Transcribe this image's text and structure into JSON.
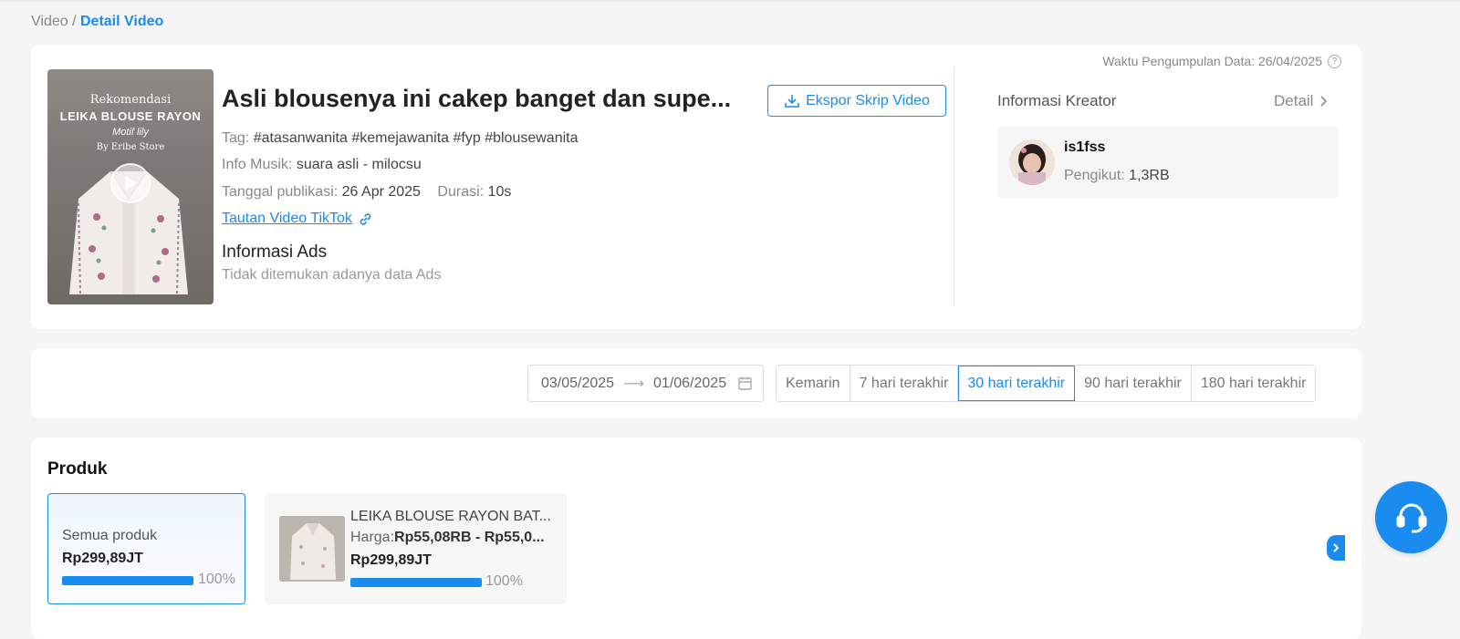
{
  "breadcrumb": {
    "root": "Video",
    "separator": "/",
    "current": "Detail Video"
  },
  "collection": {
    "label": "Waktu Pengumpulan Data: 26/04/2025"
  },
  "thumbnail": {
    "line1": "Rekomendasi",
    "line2": "LEIKA BLOUSE RAYON",
    "line3": "Motif lily",
    "line4": "By Eribe Store"
  },
  "video": {
    "title": "Asli blousenya ini cakep banget dan supe...",
    "export_label": "Ekspor Skrip Video",
    "tag_label": "Tag:",
    "tags": "#atasanwanita #kemejawanita #fyp #blousewanita",
    "music_label": "Info Musik:",
    "music": "suara asli - milocsu",
    "publish_label": "Tanggal publikasi:",
    "publish_date": "26 Apr 2025",
    "duration_label": "Durasi:",
    "duration": "10s",
    "tiktok_link": "Tautan Video TikTok"
  },
  "ads": {
    "title": "Informasi Ads",
    "empty": "Tidak ditemukan adanya data Ads"
  },
  "creator": {
    "heading": "Informasi Kreator",
    "detail_label": "Detail",
    "name": "is1fss",
    "followers_label": "Pengikut:",
    "followers": "1,3RB"
  },
  "date_filter": {
    "start": "03/05/2025",
    "end": "01/06/2025",
    "ranges": [
      "Kemarin",
      "7 hari terakhir",
      "30 hari terakhir",
      "90 hari terakhir",
      "180 hari terakhir"
    ],
    "active_range": "30 hari terakhir"
  },
  "products": {
    "title": "Produk",
    "all": {
      "label": "Semua produk",
      "amount": "Rp299,89JT",
      "percent": "100%",
      "share": 1.0
    },
    "items": [
      {
        "name": "LEIKA BLOUSE RAYON BAT...",
        "price_label": "Harga:",
        "price": "Rp55,08RB - Rp55,0...",
        "amount": "Rp299,89JT",
        "percent": "100%",
        "share": 1.0
      }
    ]
  },
  "colors": {
    "accent": "#1a8cf0",
    "background": "#f5f5f5"
  }
}
